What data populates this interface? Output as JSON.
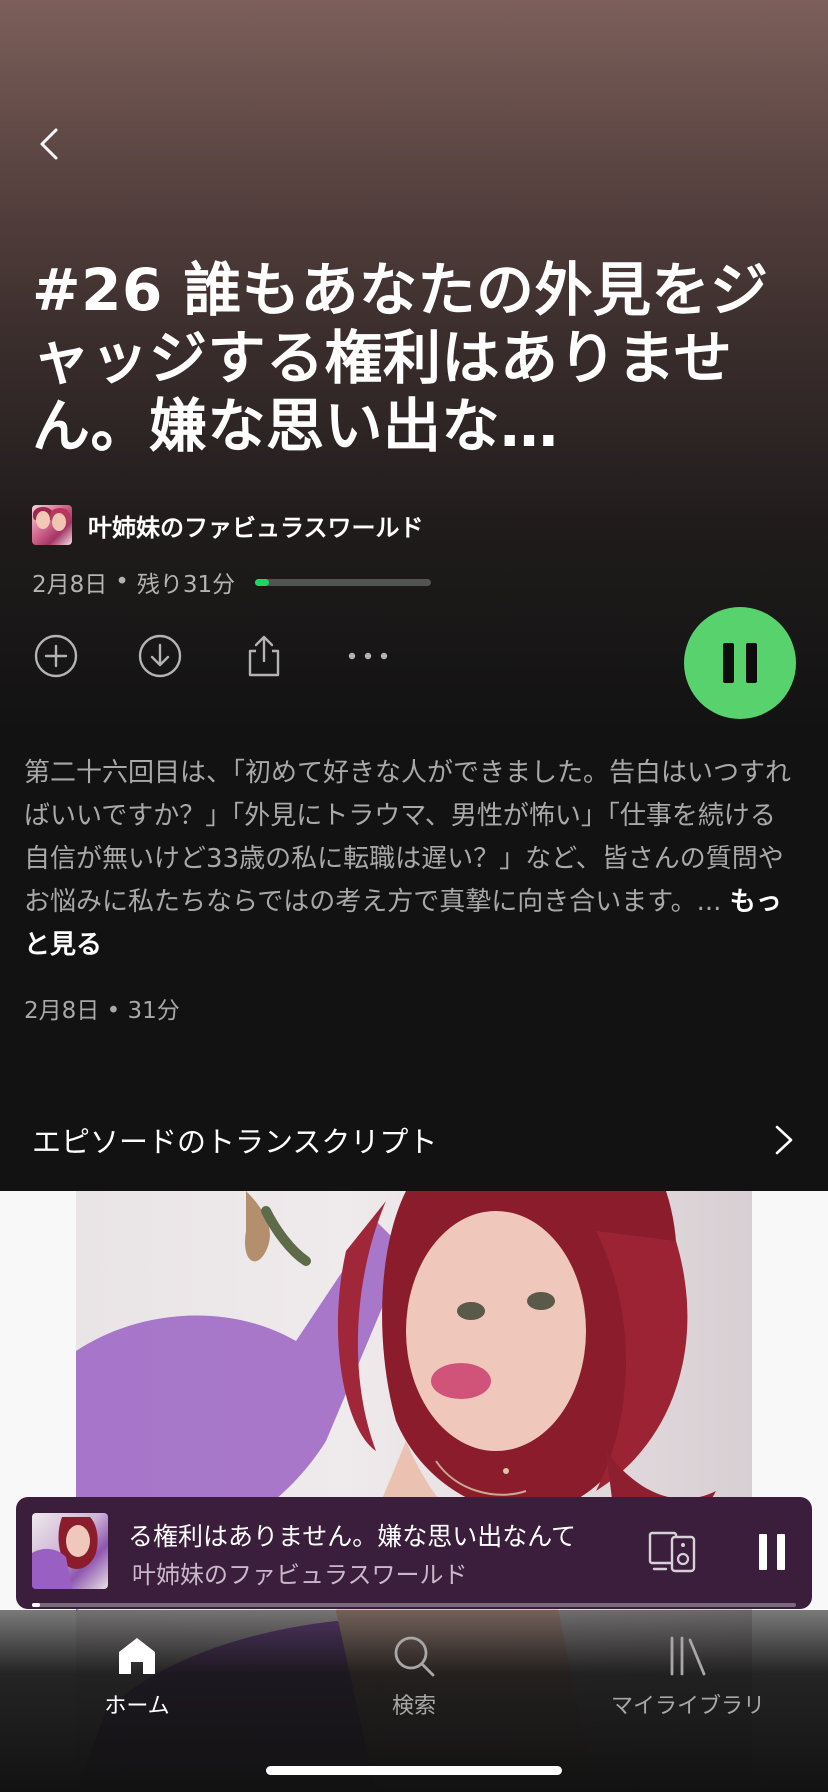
{
  "episode": {
    "title": "#26 誰もあなたの外見をジャッジする権利はありません。嫌な思い出な…",
    "show_name": "叶姉妹のファビュラスワールド",
    "meta_date": "2月8日",
    "meta_remaining": "残り31分",
    "progress": 0.08,
    "description": "第二十六回目は、「初めて好きな人ができました。告白はいつすればいいですか？」「外見にトラウマ、男性が怖い」「仕事を続ける自信が無いけど33歳の私に転職は遅い？」など、皆さんの質問やお悩みに私たちならではの考え方で真摯に向き合います。...",
    "more_label": "もっと見る",
    "footer_date": "2月8日",
    "footer_duration": "31分",
    "meta_separator": "•"
  },
  "transcript": {
    "label": "エピソードのトランスクリプト"
  },
  "mini_player": {
    "title": "る権利はありません。嫌な思い出なんて",
    "artist": "叶姉妹のファビュラスワールド",
    "progress": 0.01
  },
  "tabs": [
    {
      "label": "ホーム",
      "icon": "home-icon",
      "active": true
    },
    {
      "label": "検索",
      "icon": "search-icon",
      "active": false
    },
    {
      "label": "マイライブラリ",
      "icon": "library-icon",
      "active": false
    }
  ],
  "colors": {
    "accent": "#1ed760",
    "play_button": "#57d26d",
    "mini_player_bg": "#3a1e3b",
    "background": "#121212"
  }
}
